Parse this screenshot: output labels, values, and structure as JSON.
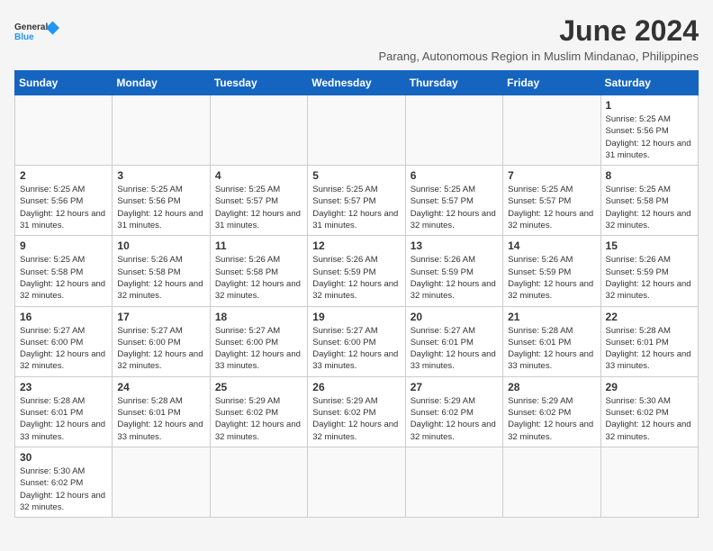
{
  "logo": {
    "text_general": "General",
    "text_blue": "Blue"
  },
  "title": "June 2024",
  "subtitle": "Parang, Autonomous Region in Muslim Mindanao, Philippines",
  "days_of_week": [
    "Sunday",
    "Monday",
    "Tuesday",
    "Wednesday",
    "Thursday",
    "Friday",
    "Saturday"
  ],
  "weeks": [
    [
      {
        "day": "",
        "info": ""
      },
      {
        "day": "",
        "info": ""
      },
      {
        "day": "",
        "info": ""
      },
      {
        "day": "",
        "info": ""
      },
      {
        "day": "",
        "info": ""
      },
      {
        "day": "",
        "info": ""
      },
      {
        "day": "1",
        "info": "Sunrise: 5:25 AM\nSunset: 5:56 PM\nDaylight: 12 hours and 31 minutes."
      }
    ],
    [
      {
        "day": "2",
        "info": "Sunrise: 5:25 AM\nSunset: 5:56 PM\nDaylight: 12 hours and 31 minutes."
      },
      {
        "day": "3",
        "info": "Sunrise: 5:25 AM\nSunset: 5:56 PM\nDaylight: 12 hours and 31 minutes."
      },
      {
        "day": "4",
        "info": "Sunrise: 5:25 AM\nSunset: 5:57 PM\nDaylight: 12 hours and 31 minutes."
      },
      {
        "day": "5",
        "info": "Sunrise: 5:25 AM\nSunset: 5:57 PM\nDaylight: 12 hours and 31 minutes."
      },
      {
        "day": "6",
        "info": "Sunrise: 5:25 AM\nSunset: 5:57 PM\nDaylight: 12 hours and 32 minutes."
      },
      {
        "day": "7",
        "info": "Sunrise: 5:25 AM\nSunset: 5:57 PM\nDaylight: 12 hours and 32 minutes."
      },
      {
        "day": "8",
        "info": "Sunrise: 5:25 AM\nSunset: 5:58 PM\nDaylight: 12 hours and 32 minutes."
      }
    ],
    [
      {
        "day": "9",
        "info": "Sunrise: 5:25 AM\nSunset: 5:58 PM\nDaylight: 12 hours and 32 minutes."
      },
      {
        "day": "10",
        "info": "Sunrise: 5:26 AM\nSunset: 5:58 PM\nDaylight: 12 hours and 32 minutes."
      },
      {
        "day": "11",
        "info": "Sunrise: 5:26 AM\nSunset: 5:58 PM\nDaylight: 12 hours and 32 minutes."
      },
      {
        "day": "12",
        "info": "Sunrise: 5:26 AM\nSunset: 5:59 PM\nDaylight: 12 hours and 32 minutes."
      },
      {
        "day": "13",
        "info": "Sunrise: 5:26 AM\nSunset: 5:59 PM\nDaylight: 12 hours and 32 minutes."
      },
      {
        "day": "14",
        "info": "Sunrise: 5:26 AM\nSunset: 5:59 PM\nDaylight: 12 hours and 32 minutes."
      },
      {
        "day": "15",
        "info": "Sunrise: 5:26 AM\nSunset: 5:59 PM\nDaylight: 12 hours and 32 minutes."
      }
    ],
    [
      {
        "day": "16",
        "info": "Sunrise: 5:27 AM\nSunset: 6:00 PM\nDaylight: 12 hours and 32 minutes."
      },
      {
        "day": "17",
        "info": "Sunrise: 5:27 AM\nSunset: 6:00 PM\nDaylight: 12 hours and 32 minutes."
      },
      {
        "day": "18",
        "info": "Sunrise: 5:27 AM\nSunset: 6:00 PM\nDaylight: 12 hours and 33 minutes."
      },
      {
        "day": "19",
        "info": "Sunrise: 5:27 AM\nSunset: 6:00 PM\nDaylight: 12 hours and 33 minutes."
      },
      {
        "day": "20",
        "info": "Sunrise: 5:27 AM\nSunset: 6:01 PM\nDaylight: 12 hours and 33 minutes."
      },
      {
        "day": "21",
        "info": "Sunrise: 5:28 AM\nSunset: 6:01 PM\nDaylight: 12 hours and 33 minutes."
      },
      {
        "day": "22",
        "info": "Sunrise: 5:28 AM\nSunset: 6:01 PM\nDaylight: 12 hours and 33 minutes."
      }
    ],
    [
      {
        "day": "23",
        "info": "Sunrise: 5:28 AM\nSunset: 6:01 PM\nDaylight: 12 hours and 33 minutes."
      },
      {
        "day": "24",
        "info": "Sunrise: 5:28 AM\nSunset: 6:01 PM\nDaylight: 12 hours and 33 minutes."
      },
      {
        "day": "25",
        "info": "Sunrise: 5:29 AM\nSunset: 6:02 PM\nDaylight: 12 hours and 32 minutes."
      },
      {
        "day": "26",
        "info": "Sunrise: 5:29 AM\nSunset: 6:02 PM\nDaylight: 12 hours and 32 minutes."
      },
      {
        "day": "27",
        "info": "Sunrise: 5:29 AM\nSunset: 6:02 PM\nDaylight: 12 hours and 32 minutes."
      },
      {
        "day": "28",
        "info": "Sunrise: 5:29 AM\nSunset: 6:02 PM\nDaylight: 12 hours and 32 minutes."
      },
      {
        "day": "29",
        "info": "Sunrise: 5:30 AM\nSunset: 6:02 PM\nDaylight: 12 hours and 32 minutes."
      }
    ],
    [
      {
        "day": "30",
        "info": "Sunrise: 5:30 AM\nSunset: 6:02 PM\nDaylight: 12 hours and 32 minutes."
      },
      {
        "day": "",
        "info": ""
      },
      {
        "day": "",
        "info": ""
      },
      {
        "day": "",
        "info": ""
      },
      {
        "day": "",
        "info": ""
      },
      {
        "day": "",
        "info": ""
      },
      {
        "day": "",
        "info": ""
      }
    ]
  ]
}
